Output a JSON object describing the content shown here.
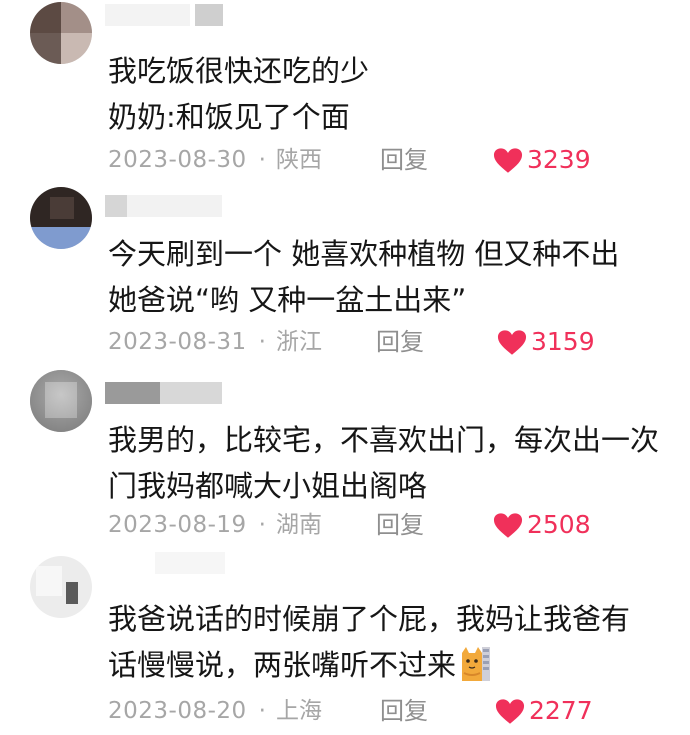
{
  "comments": [
    {
      "lines": [
        "我吃饭很快还吃的少",
        "奶奶:和饭见了个面"
      ],
      "date": "2023-08-30",
      "location": "陕西",
      "reply_label": "回复",
      "likes": "3239"
    },
    {
      "lines": [
        "今天刷到一个  她喜欢种植物  但又种不出",
        "她爸说“哟  又种一盆土出来”"
      ],
      "date": "2023-08-31",
      "location": "浙江",
      "reply_label": "回复",
      "likes": "3159"
    },
    {
      "lines": [
        "我男的，比较宅，不喜欢出门，每次出一次",
        "门我妈都喊大小姐出阁咯"
      ],
      "date": "2023-08-19",
      "location": "湖南",
      "reply_label": "回复",
      "likes": "2508"
    },
    {
      "lines": [
        "我爸说话的时候崩了个屁，我妈让我爸有",
        "话慢慢说，两张嘴听不过来"
      ],
      "date": "2023-08-20",
      "location": "上海",
      "reply_label": "回复",
      "likes": "2277"
    }
  ],
  "separator": "·",
  "icons": {
    "like": "heart-icon",
    "emoji": "cat-emoji-icon"
  },
  "colors": {
    "like": "#f0305a",
    "meta": "#a6a6a6",
    "text": "#161616"
  }
}
